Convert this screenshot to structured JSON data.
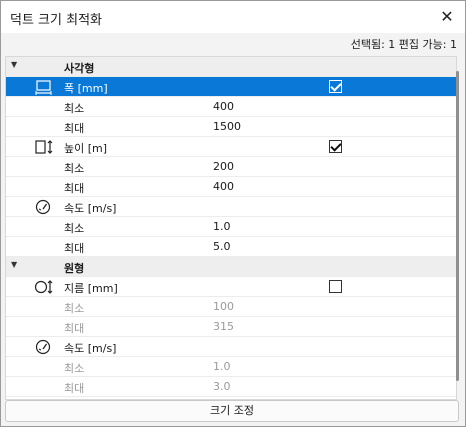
{
  "window": {
    "title": "덕트 크기 최적화",
    "close_icon": "close-icon"
  },
  "status": {
    "text": "선택됨: 1 편집 가능: 1"
  },
  "groups": {
    "rect": {
      "label": "사각형",
      "width": {
        "label": "폭 [mm]",
        "min_label": "최소",
        "min": "400",
        "max_label": "최대",
        "max": "1500",
        "checked": true
      },
      "height": {
        "label": "높이 [m]",
        "min_label": "최소",
        "min": "200",
        "max_label": "최대",
        "max": "400",
        "checked": true
      },
      "speed": {
        "label": "속도 [m/s]",
        "min_label": "최소",
        "min": "1.0",
        "max_label": "최대",
        "max": "5.0"
      }
    },
    "round": {
      "label": "원형",
      "diameter": {
        "label": "지름 [mm]",
        "min_label": "최소",
        "min": "100",
        "max_label": "최대",
        "max": "315",
        "checked": false
      },
      "speed": {
        "label": "속도 [m/s]",
        "min_label": "최소",
        "min": "1.0",
        "max_label": "최대",
        "max": "3.0"
      }
    }
  },
  "footer": {
    "button_label": "크기 조정"
  },
  "colors": {
    "selection": "#0a78d7"
  }
}
